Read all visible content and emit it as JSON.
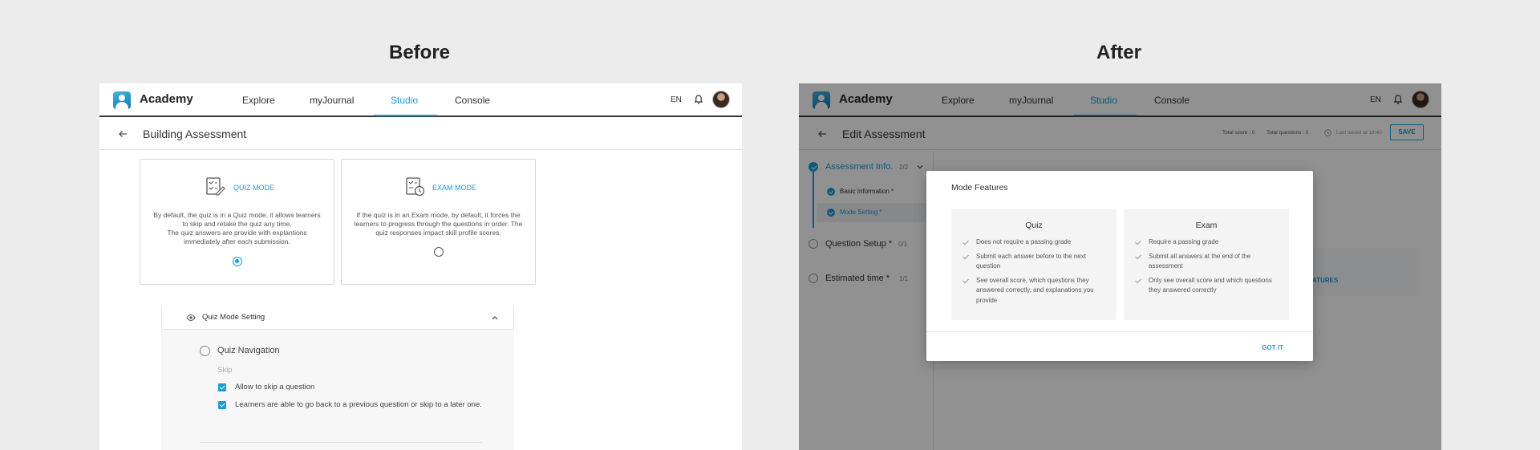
{
  "labels": {
    "before": "Before",
    "after": "After"
  },
  "nav": {
    "brand": "Academy",
    "items": [
      "Explore",
      "myJournal",
      "Studio",
      "Console"
    ],
    "active": "Studio",
    "lang": "EN"
  },
  "before": {
    "page_title": "Building Assessment",
    "modes": [
      {
        "title": "QUIZ MODE",
        "desc": "By default, the quiz is in a Quiz mode, it allows learners to skip and retake the quiz any time.\nThe quiz answers are provide with explantions immediately after each submission.",
        "selected": true
      },
      {
        "title": "EXAM MODE",
        "desc": "If the quiz is in an Exam mode, by default, it forces the learners to progress through the questions in order. The quiz responses impact skill profile scores.",
        "selected": false
      }
    ],
    "setting": {
      "title": "Quiz Mode Setting",
      "section": "Quiz Navigation",
      "group_label": "Skip",
      "options": [
        "Allow to skip a question",
        "Learners are able to go back to a previous question or skip to a later one."
      ]
    }
  },
  "after": {
    "page_title": "Edit Assessment",
    "total_score": "Total score : 0",
    "total_questions": "Total questions : 0",
    "last_saved": "Last saved at 18:40",
    "save_label": "SAVE",
    "steps": [
      {
        "title": "Assessment Info.",
        "count": "2/2"
      },
      {
        "title": "Question Setup *",
        "count": "0/1"
      },
      {
        "title": "Estimated time *",
        "count": "1/1"
      }
    ],
    "substeps": [
      "Basic Information *",
      "Mode Setting *"
    ],
    "hint_link": "ATURES",
    "modal": {
      "title": "Mode Features",
      "quiz": {
        "heading": "Quiz",
        "features": [
          "Does not require a passing grade",
          "Submit each answer before to the next question",
          "See overall score, which questions they answered correctly, and explanations you provide"
        ]
      },
      "exam": {
        "heading": "Exam",
        "features": [
          "Require a passing grade",
          "Submit all answers at the end of the assessment",
          "Only see overall score and which questions they answered correctly"
        ]
      },
      "action": "GOT IT"
    }
  },
  "colors": {
    "accent": "#1a9bd7",
    "background": "#ececec",
    "overlay": "rgba(0,0,0,0.43)"
  }
}
